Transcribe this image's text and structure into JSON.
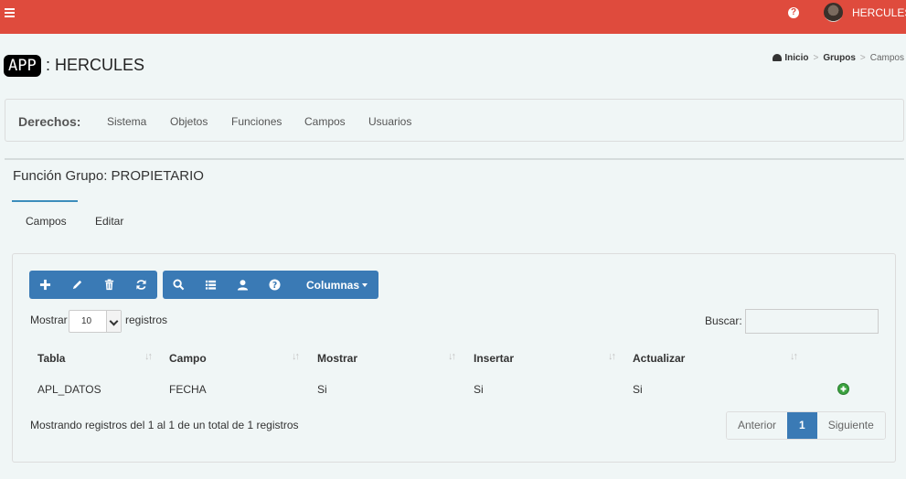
{
  "topbar": {
    "user_name": "HERCULES",
    "help_glyph": "?"
  },
  "header": {
    "app_badge": "APP",
    "app_title": ": HERCULES"
  },
  "breadcrumb": {
    "items": [
      "Inicio",
      "Grupos",
      "Campos"
    ],
    "separator": ">"
  },
  "rights": {
    "label": "Derechos:",
    "items": [
      "Sistema",
      "Objetos",
      "Funciones",
      "Campos",
      "Usuarios"
    ]
  },
  "section": {
    "title": "Función Grupo: PROPIETARIO",
    "tabs": [
      "Campos",
      "Editar"
    ]
  },
  "toolbar": {
    "icons": [
      "add-icon",
      "edit-icon",
      "delete-icon",
      "refresh-icon",
      "search-icon",
      "list-icon",
      "user-icon",
      "help-icon"
    ],
    "columns_label": "Columnas"
  },
  "controls": {
    "show_label": "Mostrar",
    "show_value": "10",
    "records_label": "registros",
    "search_label": "Buscar:",
    "search_value": ""
  },
  "table": {
    "columns": [
      "Tabla",
      "Campo",
      "Mostrar",
      "Insertar",
      "Actualizar"
    ],
    "rows": [
      [
        "APL_DATOS",
        "FECHA",
        "Si",
        "Si",
        "Si"
      ]
    ]
  },
  "footer": {
    "info": "Mostrando registros del 1 al 1 de un total de 1 registros",
    "prev": "Anterior",
    "page": "1",
    "next": "Siguiente"
  },
  "colors": {
    "topbar": "#df4b3d",
    "primary": "#3a7ab5",
    "background": "#f0f6f6",
    "add": "#3aa23e"
  }
}
